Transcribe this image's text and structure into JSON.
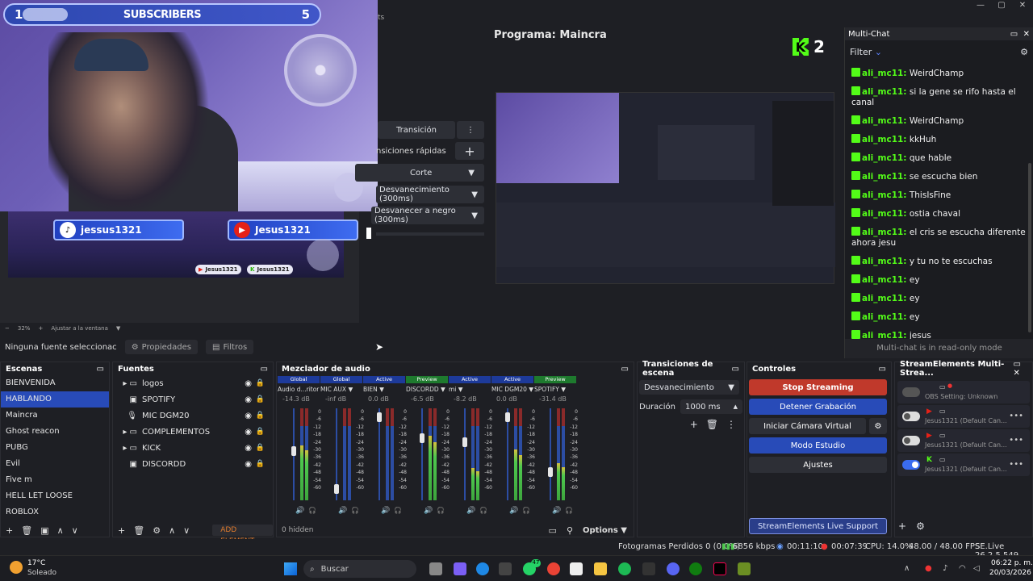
{
  "window": {
    "minimize": "—",
    "maximize": "▢",
    "close": "✕"
  },
  "overlay": {
    "subs_left": "1",
    "subs_label": "SUBSCRIBERS",
    "subs_right": "5",
    "tiktok_handle": "jessus1321",
    "youtube_handle": "Jesus1321",
    "mini_yt": "Jesus1321",
    "mini_kick": "Jesus1321"
  },
  "preview": {
    "zoom": "32%",
    "fit_label": "Ajustar a la ventana"
  },
  "transitions_mid": {
    "transition": "Transición",
    "quick": "nsiciones rápidas",
    "cut": "Corte",
    "fade": "Desvanecimiento (300ms)",
    "fade_black": "Desvanecer a negro (300ms)",
    "edge_text": "ts"
  },
  "program": {
    "title": "Programa: Maincra",
    "kick_count": "2"
  },
  "multichat": {
    "title": "Multi-Chat",
    "filter": "Filter",
    "footer": "Multi-chat is in read-only mode",
    "messages": [
      {
        "user": "ali_mc11:",
        "text": "WeirdChamp"
      },
      {
        "user": "ali_mc11:",
        "text": "si la gene se rifo hasta el canal"
      },
      {
        "user": "ali_mc11:",
        "text": "WeirdChamp"
      },
      {
        "user": "ali_mc11:",
        "text": "kkHuh"
      },
      {
        "user": "ali_mc11:",
        "text": "que hable"
      },
      {
        "user": "ali_mc11:",
        "text": "se escucha bien"
      },
      {
        "user": "ali_mc11:",
        "text": "ThisIsFine"
      },
      {
        "user": "ali_mc11:",
        "text": "ostia chaval"
      },
      {
        "user": "ali_mc11:",
        "text": "el cris se escucha diferente ahora jesu"
      },
      {
        "user": "ali_mc11:",
        "text": "y tu no te escuchas"
      },
      {
        "user": "ali_mc11:",
        "text": "ey"
      },
      {
        "user": "ali_mc11:",
        "text": "ey"
      },
      {
        "user": "ali_mc11:",
        "text": "ey"
      },
      {
        "user": "ali_mc11:",
        "text": "jesus"
      }
    ]
  },
  "propbar": {
    "no_source": "Ninguna fuente seleccionac",
    "properties": "Propiedades",
    "filters": "Filtros"
  },
  "scenes": {
    "title": "Escenas",
    "items": [
      "BIENVENIDA",
      "HABLANDO",
      "Maincra",
      "Ghost reacon",
      "PUBG",
      "Evil",
      "Five m",
      "HELL LET LOOSE",
      "ROBLOX"
    ]
  },
  "sources": {
    "title": "Fuentes",
    "add": "ADD ELEMENT",
    "items": [
      {
        "label": "logos",
        "kind": "folder"
      },
      {
        "label": "SPOTIFY",
        "kind": "window"
      },
      {
        "label": "MIC DGM20",
        "kind": "mic"
      },
      {
        "label": "COMPLEMENTOS",
        "kind": "folder"
      },
      {
        "label": "KICK",
        "kind": "folder"
      },
      {
        "label": "DISCORDD",
        "kind": "window"
      }
    ]
  },
  "mixer": {
    "title": "Mezclador de audio",
    "hidden": "0 hidden",
    "options": "Options",
    "scale": [
      "0",
      "-6",
      "-12",
      "-18",
      "-24",
      "-30",
      "-36",
      "-42",
      "-48",
      "-54",
      "-60"
    ],
    "channels": [
      {
        "tag": "Global",
        "name": "Audio d...ritorio",
        "db": "-14.3 dB",
        "level": 0.6,
        "fader": 0.55
      },
      {
        "tag": "Global",
        "name": "MIC AUX",
        "db": "-inf dB",
        "level": 0.0,
        "fader": 0.1
      },
      {
        "tag": "Active",
        "name": "BIEN",
        "db": "0.0 dB",
        "level": 0.0,
        "fader": 0.95
      },
      {
        "tag": "Preview",
        "name": "DISCORDD",
        "db": "-6.5 dB",
        "level": 0.7,
        "fader": 0.7
      },
      {
        "tag": "Active",
        "name": "mi",
        "db": "-8.2 dB",
        "level": 0.35,
        "fader": 0.65
      },
      {
        "tag": "Active",
        "name": "MIC DGM20",
        "db": "0.0 dB",
        "level": 0.55,
        "fader": 0.95
      },
      {
        "tag": "Preview",
        "name": "SPOTIFY",
        "db": "-31.4 dB",
        "level": 0.4,
        "fader": 0.3
      }
    ]
  },
  "scene_transitions": {
    "title": "Transiciones de escena",
    "type": "Desvanecimiento",
    "duration_label": "Duración",
    "duration": "1000 ms"
  },
  "controls": {
    "title": "Controles",
    "stop_streaming": "Stop Streaming",
    "stop_recording": "Detener Grabación",
    "virtual_cam": "Iniciar Cámara Virtual",
    "studio_mode": "Modo Estudio",
    "settings": "Ajustes",
    "support": "StreamElements Live Support"
  },
  "multistream": {
    "title": "StreamElements Multi-Strea...",
    "rows": [
      {
        "label": "OBS Setting: Unknown",
        "platform": "",
        "on": false
      },
      {
        "label": "Jesus1321 (Default Can...",
        "platform": "youtube",
        "on": false
      },
      {
        "label": "Jesus1321 (Default Can...",
        "platform": "youtube",
        "on": false
      },
      {
        "label": "Jesus1321 (Default Can...",
        "platform": "kick",
        "on": true
      }
    ]
  },
  "status": {
    "dropped": "Fotogramas Perdidos 0 (0.0%)",
    "bitrate": "6856 kbps",
    "stream_time": "00:11:10",
    "rec_time": "00:07:39",
    "cpu": "CPU: 14.0%",
    "fps": "48.00 / 48.00 FPS",
    "version": "SE.Live 26.2.5.549"
  },
  "taskbar": {
    "temp": "17°C",
    "weather": "Soleado",
    "search": "Buscar",
    "time": "06:22 p. m.",
    "date": "20/03/2026",
    "badge": "47"
  },
  "colors": {
    "accent": "#284bb8",
    "stop_red": "#c0392b",
    "kick_green": "#53fc18",
    "global_tag": "#1d3a9a",
    "active_tag": "#1d3a9a",
    "preview_tag": "#1e7a2e"
  }
}
